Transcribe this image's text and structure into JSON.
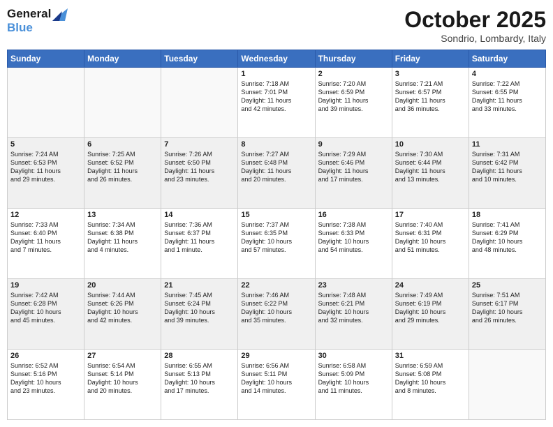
{
  "header": {
    "logo_line1": "General",
    "logo_line2": "Blue",
    "month_title": "October 2025",
    "location": "Sondrio, Lombardy, Italy"
  },
  "days_of_week": [
    "Sunday",
    "Monday",
    "Tuesday",
    "Wednesday",
    "Thursday",
    "Friday",
    "Saturday"
  ],
  "weeks": [
    [
      {
        "day": "",
        "content": ""
      },
      {
        "day": "",
        "content": ""
      },
      {
        "day": "",
        "content": ""
      },
      {
        "day": "1",
        "content": "Sunrise: 7:18 AM\nSunset: 7:01 PM\nDaylight: 11 hours\nand 42 minutes."
      },
      {
        "day": "2",
        "content": "Sunrise: 7:20 AM\nSunset: 6:59 PM\nDaylight: 11 hours\nand 39 minutes."
      },
      {
        "day": "3",
        "content": "Sunrise: 7:21 AM\nSunset: 6:57 PM\nDaylight: 11 hours\nand 36 minutes."
      },
      {
        "day": "4",
        "content": "Sunrise: 7:22 AM\nSunset: 6:55 PM\nDaylight: 11 hours\nand 33 minutes."
      }
    ],
    [
      {
        "day": "5",
        "content": "Sunrise: 7:24 AM\nSunset: 6:53 PM\nDaylight: 11 hours\nand 29 minutes."
      },
      {
        "day": "6",
        "content": "Sunrise: 7:25 AM\nSunset: 6:52 PM\nDaylight: 11 hours\nand 26 minutes."
      },
      {
        "day": "7",
        "content": "Sunrise: 7:26 AM\nSunset: 6:50 PM\nDaylight: 11 hours\nand 23 minutes."
      },
      {
        "day": "8",
        "content": "Sunrise: 7:27 AM\nSunset: 6:48 PM\nDaylight: 11 hours\nand 20 minutes."
      },
      {
        "day": "9",
        "content": "Sunrise: 7:29 AM\nSunset: 6:46 PM\nDaylight: 11 hours\nand 17 minutes."
      },
      {
        "day": "10",
        "content": "Sunrise: 7:30 AM\nSunset: 6:44 PM\nDaylight: 11 hours\nand 13 minutes."
      },
      {
        "day": "11",
        "content": "Sunrise: 7:31 AM\nSunset: 6:42 PM\nDaylight: 11 hours\nand 10 minutes."
      }
    ],
    [
      {
        "day": "12",
        "content": "Sunrise: 7:33 AM\nSunset: 6:40 PM\nDaylight: 11 hours\nand 7 minutes."
      },
      {
        "day": "13",
        "content": "Sunrise: 7:34 AM\nSunset: 6:38 PM\nDaylight: 11 hours\nand 4 minutes."
      },
      {
        "day": "14",
        "content": "Sunrise: 7:36 AM\nSunset: 6:37 PM\nDaylight: 11 hours\nand 1 minute."
      },
      {
        "day": "15",
        "content": "Sunrise: 7:37 AM\nSunset: 6:35 PM\nDaylight: 10 hours\nand 57 minutes."
      },
      {
        "day": "16",
        "content": "Sunrise: 7:38 AM\nSunset: 6:33 PM\nDaylight: 10 hours\nand 54 minutes."
      },
      {
        "day": "17",
        "content": "Sunrise: 7:40 AM\nSunset: 6:31 PM\nDaylight: 10 hours\nand 51 minutes."
      },
      {
        "day": "18",
        "content": "Sunrise: 7:41 AM\nSunset: 6:29 PM\nDaylight: 10 hours\nand 48 minutes."
      }
    ],
    [
      {
        "day": "19",
        "content": "Sunrise: 7:42 AM\nSunset: 6:28 PM\nDaylight: 10 hours\nand 45 minutes."
      },
      {
        "day": "20",
        "content": "Sunrise: 7:44 AM\nSunset: 6:26 PM\nDaylight: 10 hours\nand 42 minutes."
      },
      {
        "day": "21",
        "content": "Sunrise: 7:45 AM\nSunset: 6:24 PM\nDaylight: 10 hours\nand 39 minutes."
      },
      {
        "day": "22",
        "content": "Sunrise: 7:46 AM\nSunset: 6:22 PM\nDaylight: 10 hours\nand 35 minutes."
      },
      {
        "day": "23",
        "content": "Sunrise: 7:48 AM\nSunset: 6:21 PM\nDaylight: 10 hours\nand 32 minutes."
      },
      {
        "day": "24",
        "content": "Sunrise: 7:49 AM\nSunset: 6:19 PM\nDaylight: 10 hours\nand 29 minutes."
      },
      {
        "day": "25",
        "content": "Sunrise: 7:51 AM\nSunset: 6:17 PM\nDaylight: 10 hours\nand 26 minutes."
      }
    ],
    [
      {
        "day": "26",
        "content": "Sunrise: 6:52 AM\nSunset: 5:16 PM\nDaylight: 10 hours\nand 23 minutes."
      },
      {
        "day": "27",
        "content": "Sunrise: 6:54 AM\nSunset: 5:14 PM\nDaylight: 10 hours\nand 20 minutes."
      },
      {
        "day": "28",
        "content": "Sunrise: 6:55 AM\nSunset: 5:13 PM\nDaylight: 10 hours\nand 17 minutes."
      },
      {
        "day": "29",
        "content": "Sunrise: 6:56 AM\nSunset: 5:11 PM\nDaylight: 10 hours\nand 14 minutes."
      },
      {
        "day": "30",
        "content": "Sunrise: 6:58 AM\nSunset: 5:09 PM\nDaylight: 10 hours\nand 11 minutes."
      },
      {
        "day": "31",
        "content": "Sunrise: 6:59 AM\nSunset: 5:08 PM\nDaylight: 10 hours\nand 8 minutes."
      },
      {
        "day": "",
        "content": ""
      }
    ]
  ]
}
